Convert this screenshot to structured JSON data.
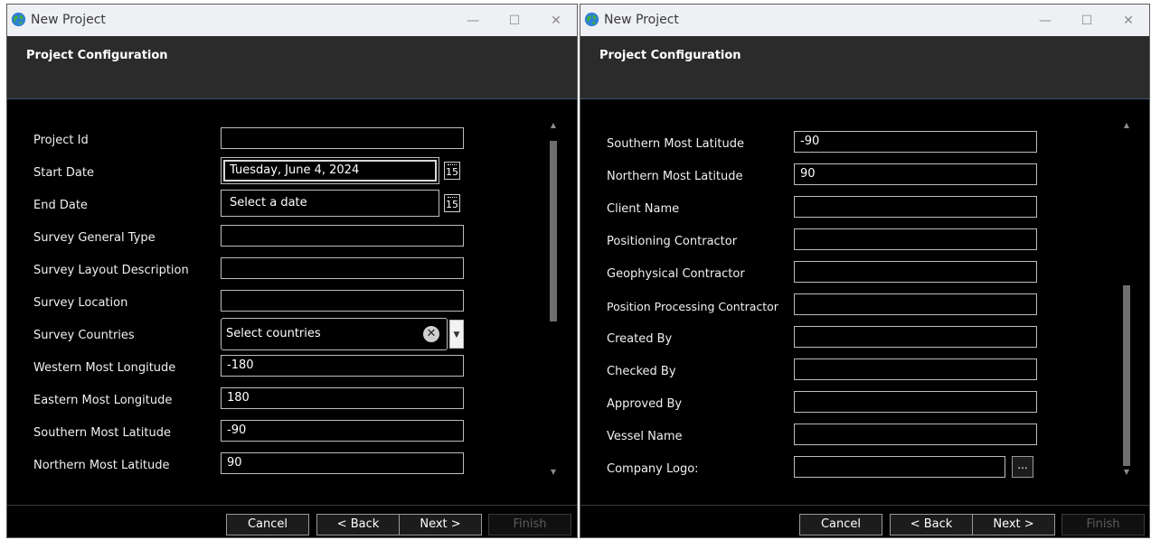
{
  "windowA": {
    "title": "New Project",
    "header_title": "Project Configuration",
    "fields": {
      "project_id": {
        "label": "Project Id",
        "value": ""
      },
      "start_date": {
        "label": "Start Date",
        "value": "Tuesday, June 4, 2024",
        "calendar_icon": "15"
      },
      "end_date": {
        "label": "End Date",
        "placeholder": "Select a date",
        "calendar_icon": "15"
      },
      "survey_general_type": {
        "label": "Survey General Type",
        "value": ""
      },
      "survey_layout_description": {
        "label": "Survey Layout Description",
        "value": ""
      },
      "survey_location": {
        "label": "Survey Location",
        "value": ""
      },
      "survey_countries": {
        "label": "Survey Countries",
        "placeholder": "Select countries",
        "clear_glyph": "✕",
        "dropdown_glyph": "▼"
      },
      "western_most_longitude": {
        "label": "Western Most Longitude",
        "value": "-180"
      },
      "eastern_most_longitude": {
        "label": "Eastern Most Longitude",
        "value": "180"
      },
      "southern_most_latitude": {
        "label": "Southern Most Latitude",
        "value": "-90"
      },
      "northern_most_latitude": {
        "label": "Northern Most Latitude",
        "value": "90"
      }
    },
    "buttons": {
      "cancel": "Cancel",
      "back": "< Back",
      "next": "Next >",
      "finish": "Finish"
    }
  },
  "windowB": {
    "title": "New Project",
    "header_title": "Project Configuration",
    "fields": {
      "southern_most_latitude": {
        "label": "Southern Most Latitude",
        "value": "-90"
      },
      "northern_most_latitude": {
        "label": "Northern Most Latitude",
        "value": "90"
      },
      "client_name": {
        "label": "Client Name",
        "value": ""
      },
      "positioning_contractor": {
        "label": "Positioning Contractor",
        "value": ""
      },
      "geophysical_contractor": {
        "label": "Geophysical Contractor",
        "value": ""
      },
      "position_processing_contractor": {
        "label": "Position Processing Contractor",
        "value": ""
      },
      "created_by": {
        "label": "Created By",
        "value": ""
      },
      "checked_by": {
        "label": "Checked By",
        "value": ""
      },
      "approved_by": {
        "label": "Approved By",
        "value": ""
      },
      "vessel_name": {
        "label": "Vessel Name",
        "value": ""
      },
      "company_logo": {
        "label": "Company Logo:",
        "value": "",
        "browse_label": "..."
      }
    },
    "buttons": {
      "cancel": "Cancel",
      "back": "< Back",
      "next": "Next >",
      "finish": "Finish"
    }
  },
  "icons": {
    "caption_minimize": "—",
    "caption_maximize": "☐",
    "caption_close": "✕",
    "scroll_up": "▲",
    "scroll_down": "▼"
  },
  "colors": {
    "window_bg": "#000000",
    "header_bg": "#2b2b2b",
    "titlebar_bg": "#eef0f3",
    "header_border": "#3d5370"
  }
}
